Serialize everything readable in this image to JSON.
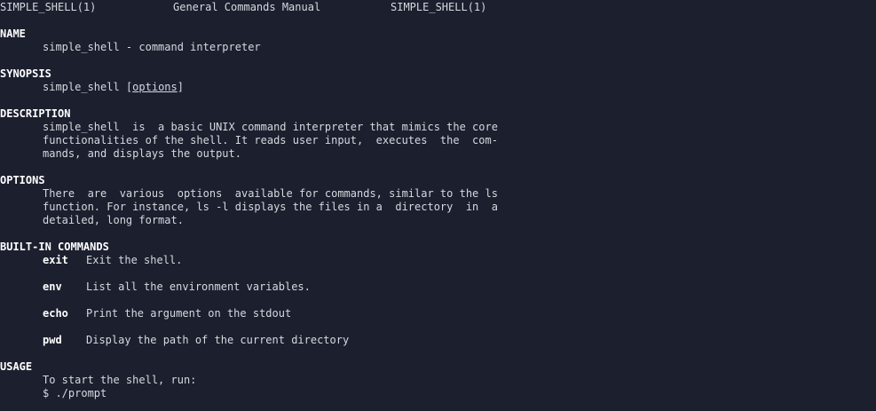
{
  "header": {
    "left": "SIMPLE_SHELL(1)",
    "center": "General Commands Manual",
    "right": "SIMPLE_SHELL(1)"
  },
  "name": {
    "heading": "NAME",
    "text": "simple_shell - command interpreter"
  },
  "synopsis": {
    "heading": "SYNOPSIS",
    "command": "simple_shell",
    "open_bracket": "[",
    "arg": "options",
    "close_bracket": "]"
  },
  "description": {
    "heading": "DESCRIPTION",
    "lines": [
      "simple_shell  is  a basic UNIX command interpreter that mimics the core",
      "functionalities of the shell. It reads user input,  executes  the  com-",
      "mands, and displays the output."
    ]
  },
  "options": {
    "heading": "OPTIONS",
    "lines": [
      "There  are  various  options  available for commands, similar to the ls",
      "function. For instance, ls -l displays the files in a  directory  in  a",
      "detailed, long format."
    ]
  },
  "builtins": {
    "heading": "BUILT-IN COMMANDS",
    "items": [
      {
        "name": "exit",
        "desc": "Exit the shell."
      },
      {
        "name": "env",
        "desc": "List all the environment variables."
      },
      {
        "name": "echo",
        "desc": "Print the argument on the stdout"
      },
      {
        "name": "pwd",
        "desc": "Display the path of the current directory"
      }
    ]
  },
  "usage": {
    "heading": "USAGE",
    "lines": [
      "To start the shell, run:",
      "$ ./prompt"
    ]
  }
}
